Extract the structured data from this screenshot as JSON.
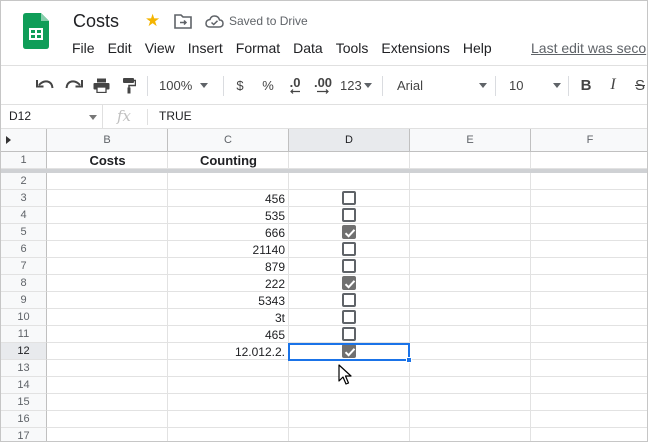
{
  "header": {
    "title": "Costs",
    "saved_status": "Saved to Drive",
    "last_edit": "Last edit was seco",
    "menu": [
      "File",
      "Edit",
      "View",
      "Insert",
      "Format",
      "Data",
      "Tools",
      "Extensions",
      "Help"
    ]
  },
  "toolbar": {
    "zoom": "100%",
    "currency": "$",
    "percent": "%",
    "decimal_decrease": ".0",
    "decimal_increase": ".00",
    "more_formats": "123",
    "font": "Arial",
    "font_size": "10",
    "bold": "B",
    "italic": "I",
    "strike": "S"
  },
  "formula_bar": {
    "cell_ref": "D12",
    "fx": "fx",
    "value": "TRUE"
  },
  "columns": [
    "B",
    "C",
    "D",
    "E",
    "F"
  ],
  "active_column": "D",
  "active_row": "12",
  "rows": [
    "1",
    "2",
    "3",
    "4",
    "5",
    "6",
    "7",
    "8",
    "9",
    "10",
    "11",
    "12",
    "13",
    "14",
    "15",
    "16",
    "17"
  ],
  "headers_row": {
    "b": "Costs",
    "c": "Counting"
  },
  "data": [
    {
      "row": "3",
      "value": "456",
      "checked": false
    },
    {
      "row": "4",
      "value": "535",
      "checked": false
    },
    {
      "row": "5",
      "value": "666",
      "checked": true
    },
    {
      "row": "6",
      "value": "21140",
      "checked": false
    },
    {
      "row": "7",
      "value": "879",
      "checked": false
    },
    {
      "row": "8",
      "value": "222",
      "checked": true
    },
    {
      "row": "9",
      "value": "5343",
      "checked": false
    },
    {
      "row": "10",
      "value": "3t",
      "checked": false
    },
    {
      "row": "11",
      "value": "465",
      "checked": false
    },
    {
      "row": "12",
      "value": "12.012.2.",
      "checked": true
    }
  ],
  "colors": {
    "accent": "#1a73e8",
    "star": "#f4b400",
    "sheets_green": "#0f9d58",
    "checkbox_checked": "#707070"
  }
}
